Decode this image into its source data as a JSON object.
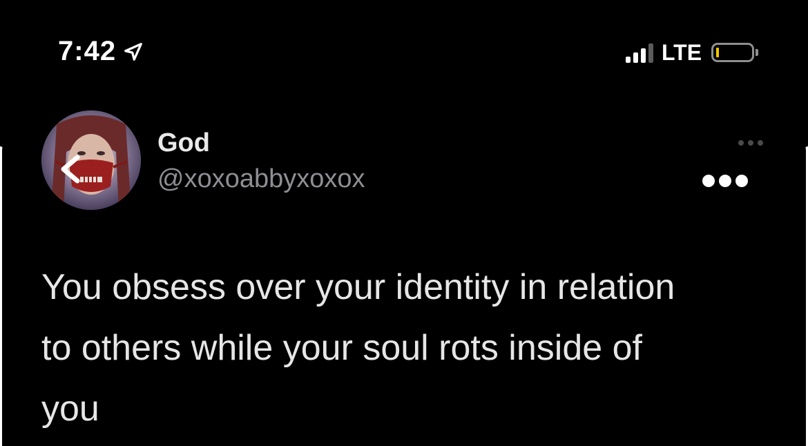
{
  "status_bar": {
    "time": "7:42",
    "network": "LTE",
    "icons": {
      "location": "location-arrow-icon",
      "signal": "cellular-signal-icon",
      "battery": "battery-icon"
    },
    "signal_bars_active": 3,
    "signal_bars_total": 4,
    "battery_level": 0.08,
    "battery_color": "#f5c400"
  },
  "tweet": {
    "author": {
      "display_name": "God",
      "handle": "@xoxoabbyxoxox"
    },
    "text": "You obsess over your identity in relation\nto others while your soul rots inside of\nyou"
  },
  "controls": {
    "back_icon": "chevron-left-icon",
    "more_icon": "ellipsis-icon"
  },
  "colors": {
    "background": "#000000",
    "text": "#e6e6e6",
    "secondary": "#8e8e93"
  }
}
